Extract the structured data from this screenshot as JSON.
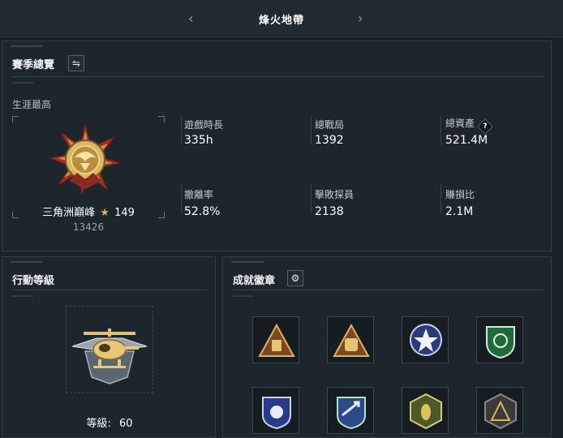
{
  "header": {
    "title": "烽火地帶"
  },
  "season_overview": {
    "title": "賽季總覽",
    "career_high_label": "生涯最高",
    "rank": {
      "name": "三角洲巔峰",
      "stars": "149",
      "score": "13426"
    },
    "stats": [
      {
        "label": "遊戲時長",
        "value": "335h"
      },
      {
        "label": "總戰局",
        "value": "1392"
      },
      {
        "label": "總資產",
        "value": "521.4M"
      },
      {
        "label": "撤離率",
        "value": "52.8%"
      },
      {
        "label": "擊敗探員",
        "value": "2138"
      },
      {
        "label": "賺損比",
        "value": "2.1M"
      }
    ],
    "help_glyph": "?"
  },
  "operation_level": {
    "title": "行動等級",
    "level_label": "等級:",
    "level_value": "60"
  },
  "achievements": {
    "title": "成就徽章",
    "badges": [
      "triangle-crate-badge",
      "triangle-bag-badge",
      "star-circle-badge",
      "green-shield-badge",
      "blue-shield-badge",
      "arrow-shield-badge",
      "wasp-hex-badge",
      "dark-triangle-badge"
    ]
  },
  "colors": {
    "background": "#1a2127",
    "panel": "#1e262d",
    "gold": "#d6b25e",
    "red": "#b23a30"
  }
}
